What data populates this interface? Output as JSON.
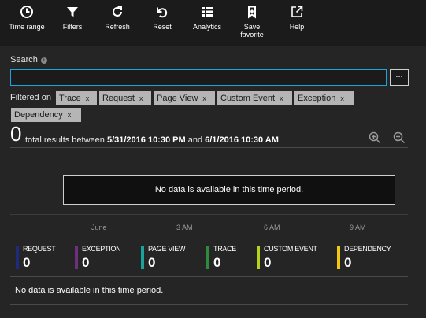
{
  "toolbar": {
    "time_range": "Time range",
    "filters": "Filters",
    "refresh": "Refresh",
    "reset": "Reset",
    "analytics": "Analytics",
    "save_favorite_line1": "Save",
    "save_favorite_line2": "favorite",
    "help": "Help"
  },
  "search": {
    "label": "Search",
    "info": "i",
    "value": "",
    "more": "..."
  },
  "filters": {
    "label": "Filtered on",
    "remove_glyph": "x",
    "chips": [
      "Trace",
      "Request",
      "Page View",
      "Custom Event",
      "Exception",
      "Dependency"
    ]
  },
  "results": {
    "count": "0",
    "text_prefix": "total results between",
    "start": "5/31/2016 10:30 PM",
    "and": "and",
    "end": "6/1/2016 10:30 AM"
  },
  "chart": {
    "no_data": "No data is available in this time period.",
    "ticks": [
      "June",
      "3 AM",
      "6 AM",
      "9 AM"
    ]
  },
  "legend": [
    {
      "label": "REQUEST",
      "value": "0",
      "color": "#1f2a7a"
    },
    {
      "label": "EXCEPTION",
      "value": "0",
      "color": "#6e2f7e"
    },
    {
      "label": "PAGE VIEW",
      "value": "0",
      "color": "#1aa39a"
    },
    {
      "label": "TRACE",
      "value": "0",
      "color": "#2e8b3e"
    },
    {
      "label": "CUSTOM EVENT",
      "value": "0",
      "color": "#b8d21a"
    },
    {
      "label": "DEPENDENCY",
      "value": "0",
      "color": "#f2c811"
    }
  ],
  "bottom": {
    "no_data": "No data is available in this time period."
  }
}
